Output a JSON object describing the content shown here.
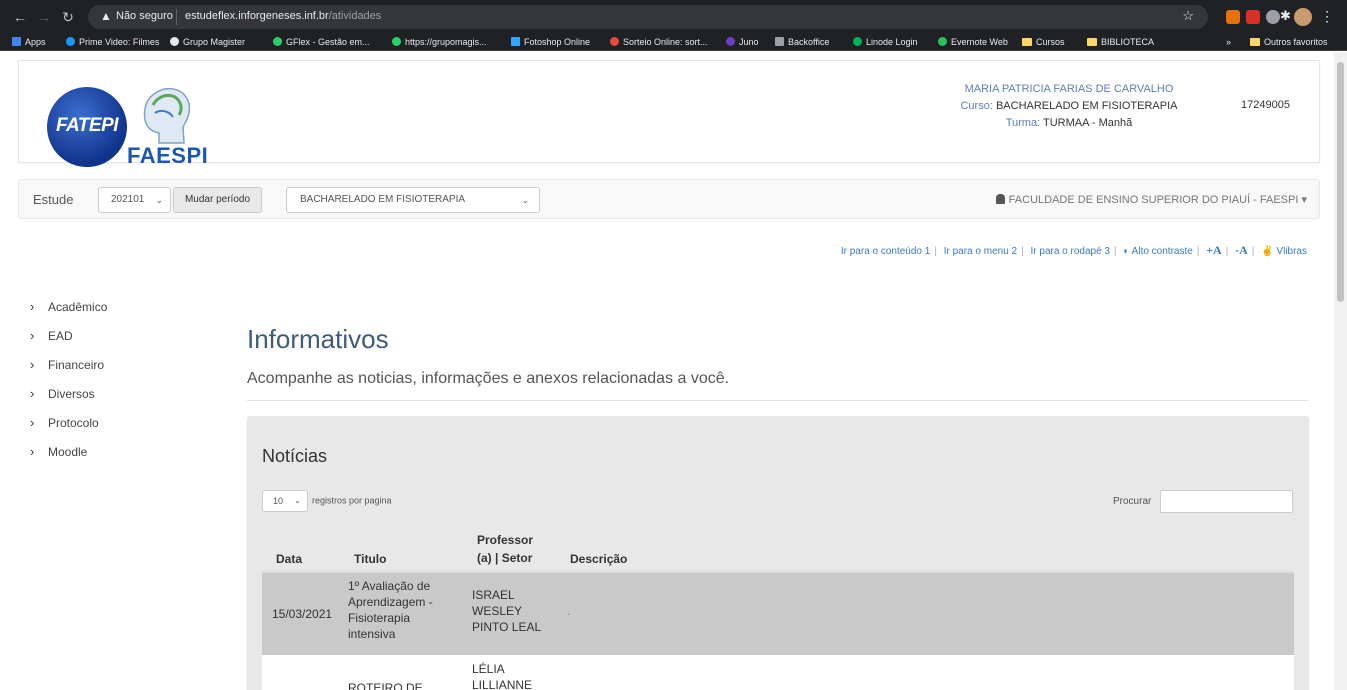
{
  "browser": {
    "warning": "Não seguro",
    "url_host": "estudeflex.inforgeneses.inf.br",
    "url_path": "/atividades",
    "bookmarks": [
      {
        "label": "Apps",
        "color": "#4285f4"
      },
      {
        "label": "Prime Video: Filmes",
        "color": "#1a98ff"
      },
      {
        "label": "Grupo Magister",
        "color": "#e8eaed"
      },
      {
        "label": "GFlex - Gestão em...",
        "color": "#2ecc71"
      },
      {
        "label": "https://grupomagis...",
        "color": "#25d366"
      },
      {
        "label": "Fotoshop Online",
        "color": "#31a8ff"
      },
      {
        "label": "Sorteio Online: sort...",
        "color": "#e74c3c"
      },
      {
        "label": "Juno",
        "color": "#6c3ec1"
      },
      {
        "label": "Backoffice",
        "color": "#9aa0a6"
      },
      {
        "label": "Linode Login",
        "color": "#02b159"
      },
      {
        "label": "Evernote Web",
        "color": "#2dbe60"
      },
      {
        "label": "Cursos",
        "color": "#fdd663"
      },
      {
        "label": "BIBLIOTECA",
        "color": "#fdd663"
      }
    ],
    "more": "»",
    "other_favorites": "Outros favoritos"
  },
  "header": {
    "logo_fatepi": "FATEPI",
    "logo_faespi": "FAESPI",
    "student_name": "MARIA PATRICIA FARIAS DE CARVALHO",
    "course_label": "Curso:",
    "course_value": "BACHARELADO EM FISIOTERAPIA",
    "class_label": "Turma:",
    "class_value": "TURMAA - Manhã",
    "student_id": "17249005"
  },
  "navbar": {
    "brand": "Estude",
    "period_value": "202101",
    "change_period_label": "Mudar período",
    "course_select_value": "BACHARELADO EM FISIOTERAPIA",
    "institution": "FACULDADE DE ENSINO SUPERIOR DO PIAUÍ - FAESPI"
  },
  "accessibility": {
    "goto_content": "Ir para o conteúdo 1",
    "goto_menu": "Ir para o menu 2",
    "goto_footer": "Ir para o rodapé 3",
    "high_contrast": "Alto contraste",
    "font_increase": "+A",
    "font_decrease": "-A",
    "vlibras": "Vlibras"
  },
  "sidebar": {
    "items": [
      {
        "label": "Acadêmico"
      },
      {
        "label": "EAD"
      },
      {
        "label": "Financeiro"
      },
      {
        "label": "Diversos"
      },
      {
        "label": "Protocolo"
      },
      {
        "label": "Moodle"
      }
    ]
  },
  "main": {
    "title": "Informativos",
    "subtitle": "Acompanhe as noticias, informações e anexos relacionadas a você."
  },
  "news": {
    "title": "Notícias",
    "per_page_value": "10",
    "per_page_label": "registros por pagina",
    "search_label": "Procurar",
    "search_value": "",
    "columns": [
      "Data",
      "Titulo",
      "Professor (a) | Setor",
      "Descrição"
    ],
    "rows": [
      {
        "date": "15/03/2021",
        "title": "1º Avaliação de Aprendizagem - Fisioterapia intensiva",
        "professor": "ISRAEL WESLEY PINTO LEAL",
        "description": "."
      },
      {
        "date": "",
        "title": "ROTEIRO DE",
        "professor": "LÉLIA LILLIANNE",
        "description": ""
      }
    ]
  }
}
